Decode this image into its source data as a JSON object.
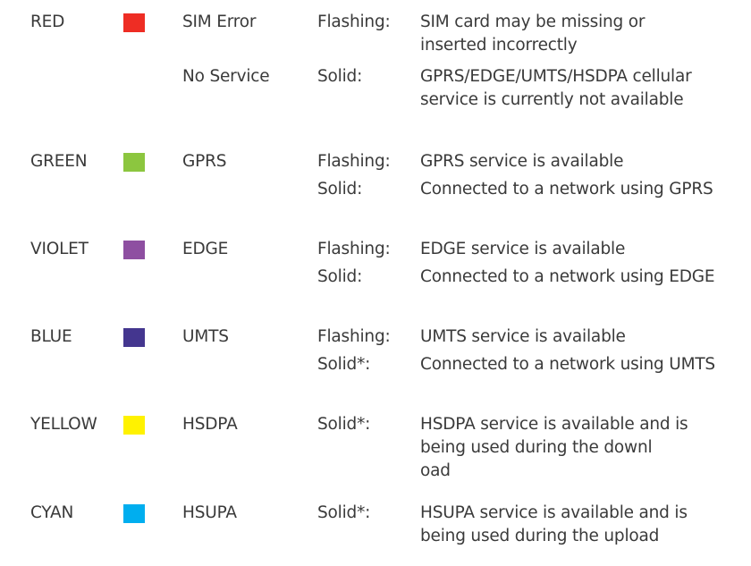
{
  "legend": {
    "rows": [
      {
        "color_name": "RED",
        "swatch_color": "#ee2d24",
        "entries": [
          {
            "service": "SIM Error",
            "mode": "Flashing:",
            "lines": [
              "SIM card may be missing or",
              "inserted incorrectly"
            ]
          },
          {
            "service": "No Service",
            "mode": "Solid:",
            "lines": [
              "GPRS/EDGE/UMTS/HSDPA cellular",
              "service is currently not available"
            ]
          }
        ]
      },
      {
        "color_name": "GREEN",
        "swatch_color": "#8cc63f",
        "entries": [
          {
            "service": "GPRS",
            "mode": "Flashing:",
            "lines": [
              "GPRS service is available"
            ]
          },
          {
            "service": "",
            "mode": "Solid:",
            "lines": [
              "Connected to a network using GPRS"
            ]
          }
        ]
      },
      {
        "color_name": "VIOLET",
        "swatch_color": "#8e4fa1",
        "entries": [
          {
            "service": "EDGE",
            "mode": "Flashing:",
            "lines": [
              "EDGE service is available"
            ]
          },
          {
            "service": "",
            "mode": "Solid:",
            "lines": [
              "Connected to a network using EDGE"
            ]
          }
        ]
      },
      {
        "color_name": "BLUE",
        "swatch_color": "#44368f",
        "entries": [
          {
            "service": "UMTS",
            "mode": "Flashing:",
            "lines": [
              "UMTS service is available"
            ]
          },
          {
            "service": "",
            "mode": "Solid*:",
            "lines": [
              "Connected to a network using UMTS"
            ]
          }
        ]
      },
      {
        "color_name": "YELLOW",
        "swatch_color": "#fff200",
        "entries": [
          {
            "service": "HSDPA",
            "mode": "Solid*:",
            "lines": [
              "HSDPA service is available and is",
              "being used during the downl",
              "oad"
            ]
          }
        ]
      },
      {
        "color_name": "CYAN",
        "swatch_color": "#00aeef",
        "entries": [
          {
            "service": "HSUPA",
            "mode": "Solid*:",
            "lines": [
              "HSUPA service is available and is",
              "being used during the upload"
            ]
          }
        ]
      }
    ]
  }
}
